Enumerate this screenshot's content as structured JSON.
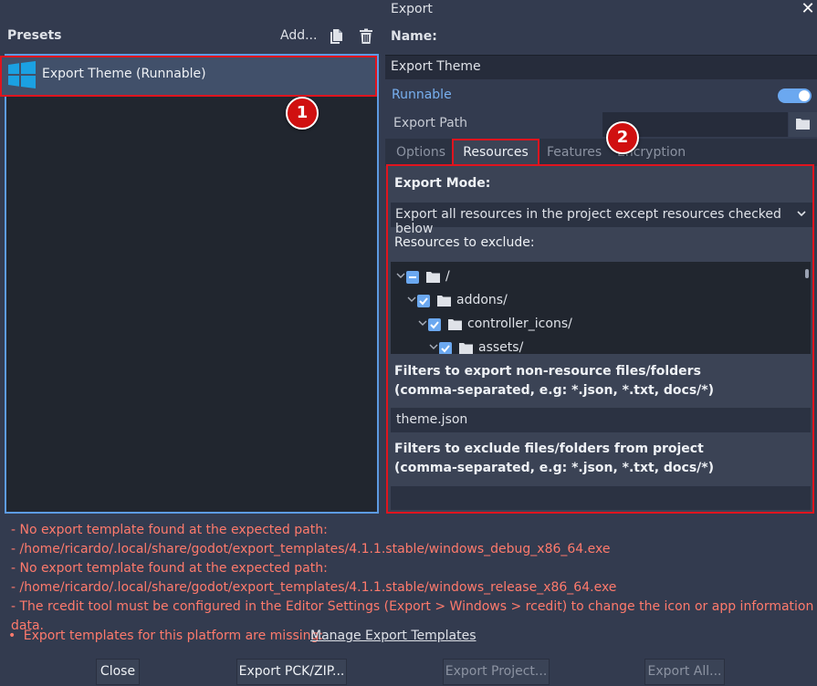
{
  "window": {
    "title": "Export",
    "close_glyph": "✕"
  },
  "presets": {
    "label": "Presets",
    "add_label": "Add...",
    "items": [
      {
        "label": "Export Theme (Runnable)",
        "icon": "windows-logo-icon"
      }
    ]
  },
  "callouts": [
    "1",
    "2"
  ],
  "form": {
    "name_label": "Name:",
    "name_value": "Export Theme",
    "runnable_label": "Runnable",
    "runnable_on": true,
    "export_path_label": "Export Path",
    "export_path_value": ""
  },
  "tabs": [
    "Options",
    "Resources",
    "Features",
    "Encryption"
  ],
  "active_tab": "Resources",
  "resources": {
    "export_mode_label": "Export Mode:",
    "export_mode_value": "Export all resources in the project except resources checked below",
    "exclude_label": "Resources to exclude:",
    "tree": [
      {
        "name": "/",
        "state": "partial"
      },
      {
        "name": "addons/",
        "state": "checked"
      },
      {
        "name": "controller_icons/",
        "state": "checked"
      },
      {
        "name": "assets/",
        "state": "checked"
      }
    ],
    "filters_include_line1": "Filters to export non-resource files/folders",
    "filters_include_line2": "(comma-separated, e.g: *.json, *.txt, docs/*)",
    "filters_include_value": "theme.json",
    "filters_exclude_line1": "Filters to exclude files/folders from project",
    "filters_exclude_line2": "(comma-separated, e.g: *.json, *.txt, docs/*)",
    "filters_exclude_value": ""
  },
  "errors": [
    "- No export template found at the expected path:",
    "- /home/ricardo/.local/share/godot/export_templates/4.1.1.stable/windows_debug_x86_64.exe",
    "- No export template found at the expected path:",
    "- /home/ricardo/.local/share/godot/export_templates/4.1.1.stable/windows_release_x86_64.exe",
    "- The rcedit tool must be configured in the Editor Settings (Export > Windows > rcedit) to change the icon or app information data."
  ],
  "warning": {
    "bullet": "•",
    "text": "Export templates for this platform are missing:",
    "link": "Manage Export Templates"
  },
  "buttons": {
    "close": "Close",
    "export_pck": "Export PCK/ZIP...",
    "export_project": "Export Project...",
    "export_all": "Export All..."
  },
  "colors": {
    "error": "#ff7a6c",
    "accent": "#6ba8f0",
    "highlight": "#e0141e"
  }
}
